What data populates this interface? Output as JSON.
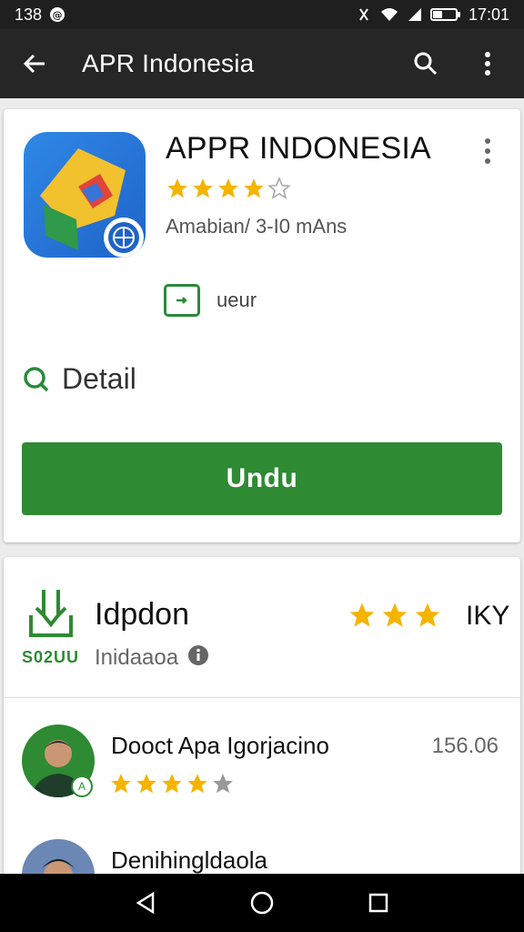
{
  "status_bar": {
    "time_left": "138",
    "time_right": "17:01"
  },
  "app_bar": {
    "title": "APR Indonesia",
    "icons": [
      "back-arrow-icon",
      "search-icon",
      "overflow-menu-icon"
    ]
  },
  "app_card": {
    "title": "APPR INDONESIA",
    "rating": 4,
    "rating_max": 5,
    "publisher": "Amabian/ 3-I0 mAns",
    "badge_label": "ueur",
    "detail_label": "Detail",
    "install_label": "Undu",
    "colors": {
      "accent": "#2e8a33",
      "star": "#f4b400",
      "icon_bg": "#2f88e6"
    }
  },
  "second_card": {
    "code": "S02UU",
    "title": "Idpdon",
    "subtitle": "Inidaaoa",
    "stars_shown": 3,
    "right_label": "IKY",
    "reviews": [
      {
        "name": "Dooct Apa Igorjacino",
        "rating": 4,
        "score": "156.06"
      },
      {
        "name": "Denihingldaola",
        "rating": 0,
        "score": ""
      }
    ]
  }
}
